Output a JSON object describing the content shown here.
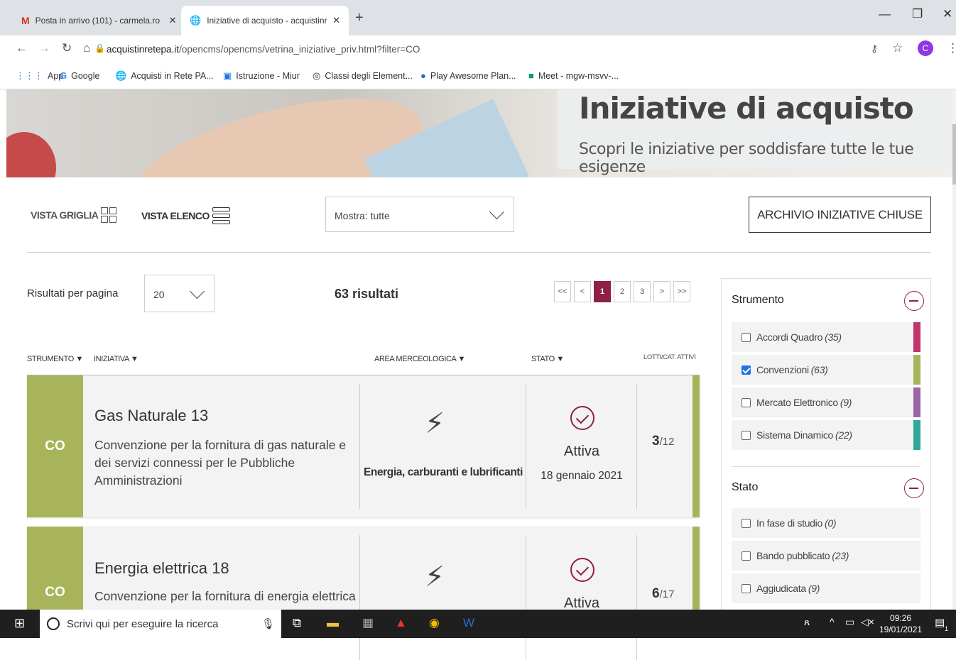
{
  "browser": {
    "tabs": [
      {
        "title": "Posta in arrivo (101) - carmela.ro",
        "icon": "gmail-icon"
      },
      {
        "title": "Iniziative di acquisto - acquistinre",
        "icon": "globe-icon"
      }
    ],
    "url_domain": "acquistinretepa.it",
    "url_path": "/opencms/opencms/vetrina_iniziative_priv.html?filter=CO",
    "profile_initial": "C",
    "bookmarks": [
      {
        "label": "App",
        "icon": "apps-grid-icon"
      },
      {
        "label": "Google",
        "icon": "google-icon"
      },
      {
        "label": "Acquisti in Rete PA...",
        "icon": "globe-icon"
      },
      {
        "label": "Istruzione - Miur",
        "icon": "miur-icon"
      },
      {
        "label": "Classi degli Element...",
        "icon": "classroom-icon"
      },
      {
        "label": "Play Awesome Plan...",
        "icon": "planet-icon"
      },
      {
        "label": "Meet - mgw-msvv-...",
        "icon": "meet-icon"
      }
    ]
  },
  "hero": {
    "title": "Iniziative di acquisto",
    "subtitle": "Scopri le iniziative per soddisfare tutte le tue esigenze"
  },
  "toolbar": {
    "grid_view": "VISTA GRIGLIA",
    "list_view": "VISTA ELENCO",
    "show_filter": "Mostra: tutte",
    "archive_button": "ARCHIVIO INIZIATIVE CHIUSE"
  },
  "results": {
    "per_page_label": "Risultati per pagina",
    "per_page_value": "20",
    "count": "63 risultati",
    "pager": [
      "<<",
      "<",
      "1",
      "2",
      "3",
      ">",
      ">>"
    ],
    "current_page": "1"
  },
  "columns": [
    "STRUMENTO",
    "INIZIATIVA",
    "AREA MERCEOLOGICA",
    "STATO",
    "LOTTI/CAT. ATTIVI"
  ],
  "cards": [
    {
      "badge": "CO",
      "title": "Gas Naturale 13",
      "description": "Convenzione per la fornitura di gas naturale e dei servizi connessi per le Pubbliche Amministrazioni",
      "area": "Energia, carburanti e lubrificanti",
      "status": "Attiva",
      "date": "18 gennaio 2021",
      "lots_active": "3",
      "lots_total": "/12"
    },
    {
      "badge": "CO",
      "title": "Energia elettrica 18",
      "description": "Convenzione per la fornitura di energia elettrica",
      "area": "",
      "status": "Attiva",
      "date": "",
      "lots_active": "6",
      "lots_total": "/17"
    }
  ],
  "sidebar": {
    "strumento_title": "Strumento",
    "strumento_items": [
      {
        "label": "Accordi Quadro",
        "count": "(35)",
        "checked": false,
        "color": "#c2356b"
      },
      {
        "label": "Convenzioni",
        "count": "(63)",
        "checked": true,
        "color": "#a8b45a"
      },
      {
        "label": "Mercato Elettronico",
        "count": "(9)",
        "checked": false,
        "color": "#9966aa"
      },
      {
        "label": "Sistema Dinamico",
        "count": "(22)",
        "checked": false,
        "color": "#2fa89a"
      }
    ],
    "stato_title": "Stato",
    "stato_items": [
      {
        "label": "In fase di studio",
        "count": "(0)",
        "checked": false
      },
      {
        "label": "Bando pubblicato",
        "count": "(23)",
        "checked": false
      },
      {
        "label": "Aggiudicata",
        "count": "(9)",
        "checked": false
      }
    ]
  },
  "taskbar": {
    "search_placeholder": "Scrivi qui per eseguire la ricerca",
    "time": "09:26",
    "date": "19/01/2021",
    "notifications": "1"
  },
  "colors": {
    "accent": "#8e2044",
    "convenzioni": "#a8b45a"
  }
}
